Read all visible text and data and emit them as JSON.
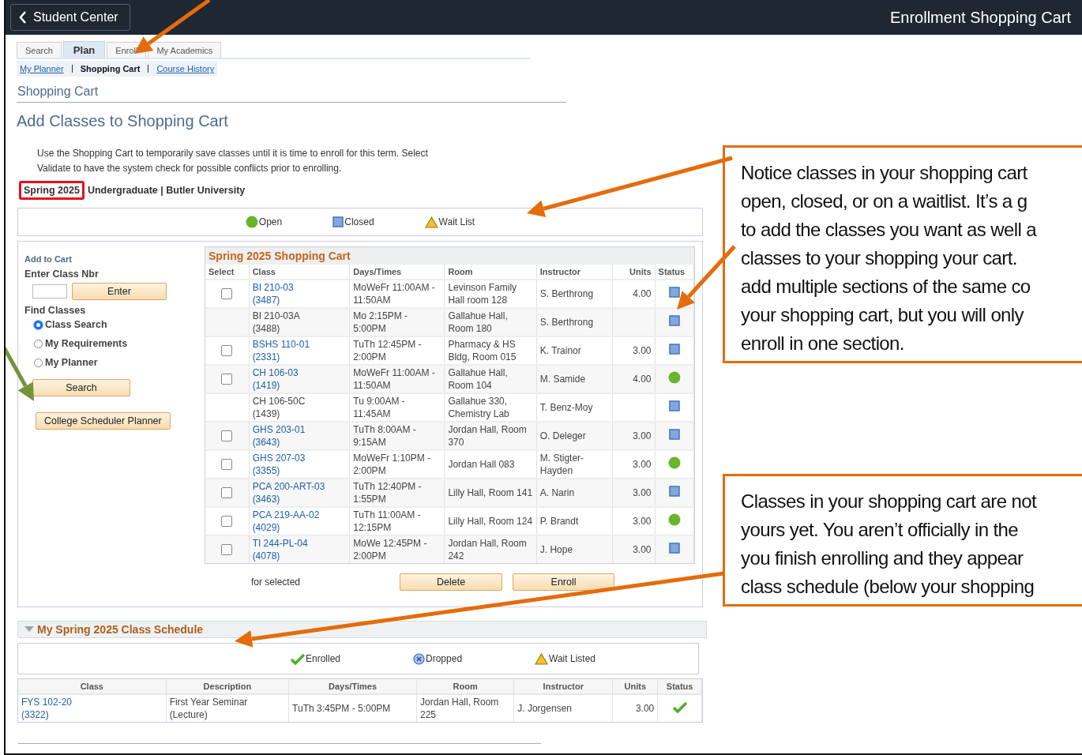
{
  "header": {
    "back_label": "Student Center",
    "title": "Enrollment Shopping Cart"
  },
  "tabs": [
    {
      "label": "Search",
      "selected": false
    },
    {
      "label": "Plan",
      "selected": true
    },
    {
      "label": "Enroll",
      "selected": false
    },
    {
      "label": "My Academics",
      "selected": false
    }
  ],
  "subnav": [
    {
      "label": "My Planner",
      "selected": false
    },
    {
      "label": "Shopping Cart",
      "selected": true
    },
    {
      "label": "Course History",
      "selected": false
    }
  ],
  "page_title": "Shopping Cart",
  "heading": "Add Classes to Shopping Cart",
  "instructions": "Use the Shopping Cart to temporarily save classes until it is time to enroll for this term.  Select Validate to have the system check for possible conflicts prior to enrolling.",
  "term": {
    "label": "Spring 2025",
    "highlighted": true,
    "career": "Undergraduate | Butler University"
  },
  "legend": [
    {
      "kind": "open",
      "label": "Open"
    },
    {
      "kind": "closed",
      "label": "Closed"
    },
    {
      "kind": "waitlist",
      "label": "Wait List"
    }
  ],
  "add_to_cart": {
    "title": "Add to Cart",
    "enter_label": "Enter Class Nbr",
    "enter_button": "Enter",
    "find_label": "Find Classes",
    "options": [
      {
        "label": "Class Search",
        "selected": true
      },
      {
        "label": "My Requirements",
        "selected": false
      },
      {
        "label": "My Planner",
        "selected": false
      }
    ],
    "search_button": "Search",
    "planner_button": "College Scheduler Planner"
  },
  "cart": {
    "title": "Spring 2025 Shopping Cart",
    "columns": [
      "Select",
      "Class",
      "Days/Times",
      "Room",
      "Instructor",
      "Units",
      "Status"
    ],
    "rows": [
      {
        "selectable": true,
        "checked": false,
        "class": "BI 210-03",
        "class_nbr": "(3487)",
        "days_times": "MoWeFr 11:00AM - 11:50AM",
        "room": "Levinson Family Hall room 128",
        "instructor": "S. Berthrong",
        "units": "4.00",
        "kind": "closed"
      },
      {
        "selectable": false,
        "class": "BI 210-03A",
        "class_nbr": "(3488)",
        "days_times": "Mo 2:15PM - 5:00PM",
        "room": "Gallahue Hall, Room 180",
        "instructor": "S. Berthrong",
        "kind": "closed"
      },
      {
        "selectable": true,
        "checked": false,
        "class": "BSHS 110-01",
        "class_nbr": "(2331)",
        "days_times": "TuTh 12:45PM - 2:00PM",
        "room": "Pharmacy & HS Bldg, Room 015",
        "instructor": "K. Trainor",
        "units": "3.00",
        "kind": "closed"
      },
      {
        "selectable": true,
        "checked": false,
        "class": "CH 106-03",
        "class_nbr": "(1419)",
        "days_times": "MoWeFr 11:00AM - 11:50AM",
        "room": "Gallahue Hall, Room 104",
        "instructor": "M. Samide",
        "units": "4.00",
        "kind": "open"
      },
      {
        "selectable": false,
        "class": "CH 106-50C",
        "class_nbr": "(1439)",
        "days_times": "Tu 9:00AM - 11:45AM",
        "room": "Gallahue 330, Chemistry Lab",
        "instructor": "T. Benz-Moy",
        "kind": "closed"
      },
      {
        "selectable": true,
        "checked": false,
        "class": "GHS 203-01",
        "class_nbr": "(3643)",
        "days_times": "TuTh 8:00AM - 9:15AM",
        "room": "Jordan Hall, Room 370",
        "instructor": "O. Deleger",
        "units": "3.00",
        "kind": "closed"
      },
      {
        "selectable": true,
        "checked": false,
        "class": "GHS 207-03",
        "class_nbr": "(3355)",
        "days_times": "MoWeFr 1:10PM - 2:00PM",
        "room": "Jordan Hall 083",
        "instructor": "M. Stigter-Hayden",
        "units": "3.00",
        "kind": "open"
      },
      {
        "selectable": true,
        "checked": false,
        "class": "PCA 200-ART-03",
        "class_nbr": "(3463)",
        "days_times": "TuTh 12:40PM - 1:55PM",
        "room": "Lilly Hall, Room 141",
        "instructor": "A. Narin",
        "units": "3.00",
        "kind": "closed"
      },
      {
        "selectable": true,
        "checked": false,
        "class": "PCA 219-AA-02",
        "class_nbr": "(4029)",
        "days_times": "TuTh 11:00AM - 12:15PM",
        "room": "Lilly Hall, Room 124",
        "instructor": "P. Brandt",
        "units": "3.00",
        "kind": "open"
      },
      {
        "selectable": true,
        "checked": false,
        "class": "TI 244-PL-04",
        "class_nbr": "(4078)",
        "days_times": "MoWe 12:45PM - 2:00PM",
        "room": "Jordan Hall, Room 242",
        "instructor": "J. Hope",
        "units": "3.00",
        "kind": "closed"
      }
    ],
    "footer_label": "for selected",
    "buttons": [
      "Delete",
      "Enroll"
    ]
  },
  "schedule": {
    "title": "My Spring 2025 Class Schedule",
    "expanded": true,
    "legend": [
      {
        "kind": "enrolled",
        "label": "Enrolled"
      },
      {
        "kind": "dropped",
        "label": "Dropped"
      },
      {
        "kind": "waitlist",
        "label": "Wait Listed"
      }
    ],
    "columns": [
      "Class",
      "Description",
      "Days/Times",
      "Room",
      "Instructor",
      "Units",
      "Status"
    ],
    "rows": [
      {
        "class": "FYS 102-20",
        "class_nbr": "(3322)",
        "description": "First Year Seminar (Lecture)",
        "days_times": "TuTh 3:45PM - 5:00PM",
        "room": "Jordan Hall, Room 225",
        "instructor": "J. Jorgensen",
        "units": "3.00",
        "kind": "enrolled"
      }
    ]
  },
  "callouts": [
    {
      "lines": [
        "Notice classes in your shopping cart",
        "open, closed, or on a waitlist. It’s a g",
        "to add the classes you want as well a",
        "classes to your shopping your cart.",
        "add multiple sections of the same co",
        "your shopping cart, but you will only",
        "enroll in one section."
      ]
    },
    {
      "lines": [
        "Classes in your shopping cart are not",
        "yours yet. You aren’t officially in the",
        "you finish enrolling and they appear",
        "class schedule (below your shopping"
      ]
    }
  ]
}
